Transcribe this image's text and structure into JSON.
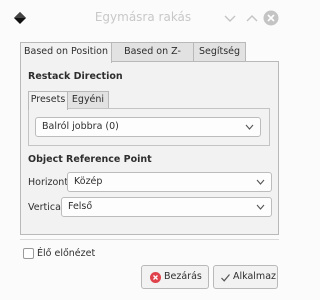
{
  "window": {
    "title": "Egymásra rakás"
  },
  "tabs": [
    {
      "label": "Based on Position",
      "active": true
    },
    {
      "label": "Based on Z-Order",
      "active": false
    },
    {
      "label": "Segítség",
      "active": false
    }
  ],
  "restack": {
    "heading": "Restack Direction",
    "subtabs": [
      {
        "label": "Presets",
        "active": true
      },
      {
        "label": "Egyéni",
        "active": false
      }
    ],
    "direction_value": "Balról jobbra (0)"
  },
  "reference": {
    "heading": "Object Reference Point",
    "horizontal_label": "Horizontal:",
    "horizontal_value": "Közép",
    "vertical_label": "Vertical:",
    "vertical_value": "Felső"
  },
  "live_preview": {
    "label": "Élő előnézet",
    "checked": false
  },
  "buttons": {
    "close_label": "Bezárás",
    "apply_label": "Alkalmaz"
  },
  "colors": {
    "close_icon": "#e0424b",
    "titlebar_buttons": "#c4c4c4"
  }
}
